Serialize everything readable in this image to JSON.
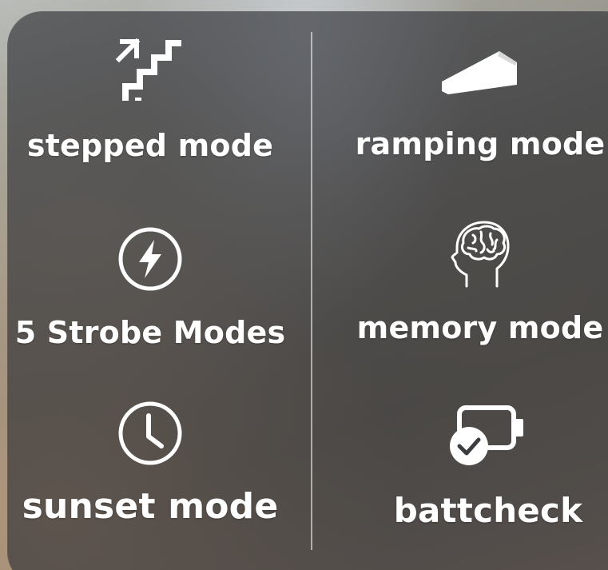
{
  "features": {
    "stepped": {
      "label": "stepped mode",
      "icon": "stairs-arrow-icon"
    },
    "ramping": {
      "label": "ramping mode",
      "icon": "ramp-icon"
    },
    "strobe": {
      "label": "5 Strobe Modes",
      "icon": "lightning-bolt-icon"
    },
    "memory": {
      "label": "memory mode",
      "icon": "brain-head-icon"
    },
    "sunset": {
      "label": "sunset mode",
      "icon": "clock-icon"
    },
    "battcheck": {
      "label": "battcheck",
      "icon": "battery-check-icon"
    }
  },
  "colors": {
    "panel": "#2a2c30",
    "text": "#ffffff",
    "divider": "#ffffff"
  }
}
